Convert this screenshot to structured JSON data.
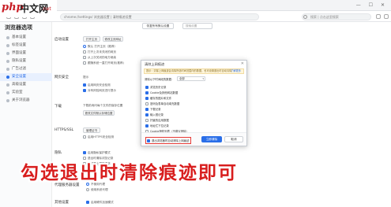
{
  "logo": {
    "brand": "php",
    "text": "中文网",
    "suffix": ".net"
  },
  "browser": {
    "address": "chrome://settings/     浏览器设置 | 清除痕迹设置",
    "search_placeholder": "搜索 | 点击这里搜索",
    "window_controls": "— ☐ ✕"
  },
  "sidebar": {
    "title": "浏览器选项",
    "items": [
      {
        "label": "基本设置"
      },
      {
        "label": "标签设置"
      },
      {
        "label": "界面设置"
      },
      {
        "label": "隐私设置"
      },
      {
        "label": "广告过滤"
      },
      {
        "label": "安全设置"
      },
      {
        "label": "高级设置"
      },
      {
        "label": "实验室"
      },
      {
        "label": "关于浏览器"
      }
    ],
    "active_index": 5
  },
  "main": {
    "restore_label": "恢复所有默认设置",
    "search_placeholder": "搜索设置",
    "sections": {
      "startup": {
        "title": "启动设置",
        "btn1": "打开主页",
        "btn2": "修改主页网址",
        "rows": [
          "默认 打开主页（推荐）",
          "打开上次未关闭的网页",
          "从上次关闭的地方继续",
          "跟随系统一直打开网页(推荐)"
        ]
      },
      "security": {
        "title": "网页安全",
        "label": "提示",
        "rows": [
          "启用网页安全检测",
          "对有风险网页进行提示"
        ]
      },
      "download": {
        "title": "下载",
        "text": "下载前询问每个文件的保存位置",
        "btn": "更改文件默认存储位置"
      },
      "https": {
        "title": "HTTPS/SSL",
        "btn": "管理证书",
        "row": "启用HTTPS安全检测"
      },
      "privacy": {
        "title": "隐私",
        "rows": [
          "启用隐私保护模式",
          "退出时清除浏览记录",
          "发送禁止跟踪请求"
        ]
      },
      "proxy": {
        "title": "代理服务器设置",
        "rows": [
          "不使用代理",
          "使用系统代理"
        ]
      },
      "other": {
        "title": "其他设置",
        "row": "启用硬件加速模式"
      }
    }
  },
  "dialog": {
    "title": "清除上网痕迹",
    "close": "✕",
    "note": "提示：清除上网痕迹会清除所选时间范围内的数据，也可设置退出时自动清除",
    "note_link": "了解更多",
    "range_label": "清除以下时间段的数据：",
    "range_value": "全部",
    "range_caret": "▾",
    "items": [
      {
        "label": "浏览历史记录",
        "checked": true
      },
      {
        "label": "Cookie及其他网站数据",
        "checked": true
      },
      {
        "label": "缓存的图片和文件",
        "checked": true
      },
      {
        "label": "密码及表单自动填充数据",
        "checked": false
      },
      {
        "label": "下载记录",
        "checked": true
      },
      {
        "label": "输入框记录",
        "checked": true
      },
      {
        "label": "托管的应用数据",
        "checked": false
      },
      {
        "label": "地址栏下拉记录",
        "checked": true
      },
      {
        "label": "Cookie授权列表（不建议清除）",
        "checked": false
      }
    ],
    "footer_checkbox": "退出浏览器时自动清除上网痕迹",
    "footer_checked": true,
    "confirm": "立即清除",
    "cancel": "取消"
  },
  "caption": "勾选退出时清除痕迹即可",
  "colors": {
    "accent": "#2a6ee8",
    "caption": "#d81e1e",
    "highlight": "#e53935"
  }
}
